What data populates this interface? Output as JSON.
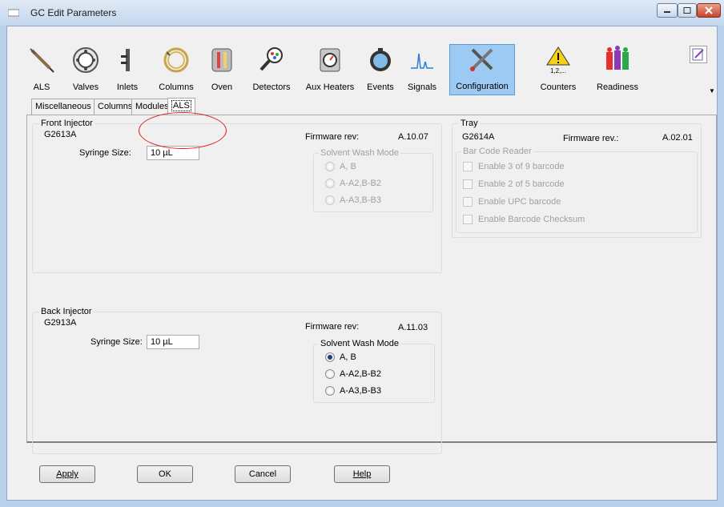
{
  "window": {
    "title": "GC Edit Parameters"
  },
  "toolbar": {
    "items": [
      {
        "label": "ALS",
        "icon": "syringe-icon"
      },
      {
        "label": "Valves",
        "icon": "valve-icon"
      },
      {
        "label": "Inlets",
        "icon": "inlet-icon"
      },
      {
        "label": "Columns",
        "icon": "column-icon"
      },
      {
        "label": "Oven",
        "icon": "oven-icon"
      },
      {
        "label": "Detectors",
        "icon": "detector-icon"
      },
      {
        "label": "Aux Heaters",
        "icon": "aux-heater-icon"
      },
      {
        "label": "Events",
        "icon": "events-icon"
      },
      {
        "label": "Signals",
        "icon": "signal-icon"
      },
      {
        "label": "Configuration",
        "icon": "configuration-icon"
      },
      {
        "label": "Counters",
        "icon": "counters-icon",
        "badge": "1,2,..."
      },
      {
        "label": "Readiness",
        "icon": "readiness-icon"
      }
    ],
    "selected": "Configuration"
  },
  "tabs": [
    "Miscellaneous",
    "Columns",
    "Modules",
    "ALS"
  ],
  "active_tab": "ALS",
  "front_injector": {
    "group_title": "Front Injector",
    "model": "G2613A",
    "firmware_label": "Firmware rev:",
    "firmware": "A.10.07",
    "syringe_label": "Syringe Size:",
    "syringe_value": "10 µL",
    "wash_title": "Solvent Wash Mode",
    "wash_options": [
      "A, B",
      "A-A2,B-B2",
      "A-A3,B-B3"
    ]
  },
  "back_injector": {
    "group_title": "Back Injector",
    "model": "G2913A",
    "firmware_label": "Firmware rev:",
    "firmware": "A.11.03",
    "syringe_label": "Syringe Size:",
    "syringe_value": "10 µL",
    "wash_title": "Solvent Wash Mode",
    "wash_options": [
      "A, B",
      "A-A2,B-B2",
      "A-A3,B-B3"
    ],
    "wash_selected": "A, B"
  },
  "tray": {
    "group_title": "Tray",
    "model": "G2614A",
    "firmware_label": "Firmware rev.:",
    "firmware": "A.02.01",
    "barcode_title": "Bar Code Reader",
    "barcode_options": [
      "Enable 3 of 9 barcode",
      "Enable 2 of 5 barcode",
      "Enable UPC barcode",
      "Enable Barcode Checksum"
    ]
  },
  "buttons": {
    "apply": "Apply",
    "ok": "OK",
    "cancel": "Cancel",
    "help": "Help"
  },
  "colors": {
    "selected_tool": "#9ccaf2",
    "annotation": "#e02020"
  }
}
